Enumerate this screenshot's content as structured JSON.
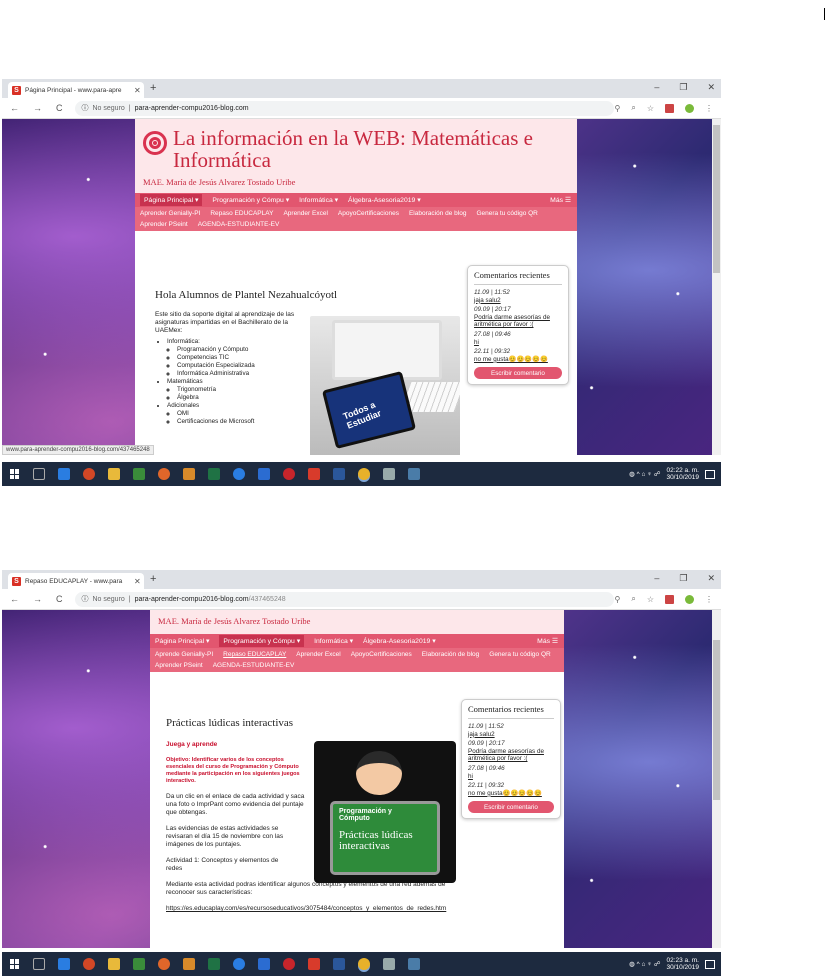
{
  "screen1": {
    "tab_title": "Página Principal - www.para-apre",
    "omnibox": {
      "security": "No seguro",
      "host": "para-aprender-compu2016-blog.com",
      "path": ""
    },
    "blog": {
      "title": "La información en la WEB: Matemáticas e Informática",
      "author": "MAE. María de Jesús Alvarez Tostado Uribe",
      "menu_primary": [
        "Página Principal ▾",
        "Programación y Cómpu ▾",
        "Informática ▾",
        "Álgebra-Asesoria2019 ▾"
      ],
      "menu_more": "Más ☰",
      "menu_secondary": [
        "Aprender Genially-PI",
        "Repaso EDUCAPLAY",
        "Aprender Excel",
        "ApoyoCertificaciones",
        "Elaboración de blog",
        "Genera tu código QR",
        "Aprender PSeint",
        "AGENDA-ESTUDIANTE-EV"
      ]
    },
    "post": {
      "title": "Hola Alumnos de Plantel Nezahualcóyotl",
      "intro": "Este sitio da soporte digital al aprendizaje de las asignaturas impartidas en el Bachillerato de la UAEMex:",
      "informatica": "Informática:",
      "informatica_items": [
        "Programación y Cómputo",
        "Competencias TIC",
        "Computación Especializada",
        "Informática Administrativa"
      ],
      "matematicas": "Matemáticas",
      "matematicas_items": [
        "Trigonometría",
        "Álgebra"
      ],
      "adicionales": "Adicionales",
      "adicionales_items": [
        "OMI",
        "Certificaciones de Microsoft"
      ],
      "image_text": "Todos a Estudiar"
    },
    "status_url": "www.para-aprender-compu2016-blog.com/437465248",
    "clock": {
      "time": "02:22 a. m.",
      "date": "30/10/2019"
    }
  },
  "screen2": {
    "tab_title": "Repaso EDUCAPLAY - www.para",
    "omnibox": {
      "security": "No seguro",
      "host": "para-aprender-compu2016-blog.com",
      "path": "/437465248"
    },
    "blog": {
      "author": "MAE. María de Jesús Alvarez Tostado Uribe",
      "menu_primary": [
        "Página Principal ▾",
        "Programación y Cómpu ▾",
        "Informática ▾",
        "Álgebra-Asesoria2019 ▾"
      ],
      "menu_more": "Más ☰",
      "menu_secondary": [
        "Aprende Genially-PI",
        "Repaso EDUCAPLAY",
        "Aprender Excel",
        "ApoyoCertificaciones",
        "Elaboración de blog",
        "Genera tu código QR",
        "Aprender PSeint",
        "AGENDA-ESTUDIANTE-EV"
      ]
    },
    "post": {
      "title": "Prácticas lúdicas interactivas",
      "subtitle": "Juega y aprende",
      "objective": "Objetivo: Identificar varios de los conceptos esenciales del curso de Programación y Cómputo mediante la participación en los siguientes juegos interactivo.",
      "p1": "Da un clic en el enlace de cada actividad y saca una foto o ImprPant como evidencia del puntaje que obtengas.",
      "p2": "Las evidencias de estas actividades se revisaran el día 15 de noviembre con las imágenes de los puntajes.",
      "activity": "Actividad 1: Conceptos y elementos de redes",
      "p3": "Mediante esta actividad podras identificar algunos conceptos y elementos de una red además de reconocer sus características:",
      "link": "https://es.educaplay.com/es/recursoseducativos/3075484/conceptos_y_elementos_de_redes.htm",
      "sign_top": "Programación y Cómputo",
      "sign_main": "Prácticas lúdicas interactivas"
    },
    "clock": {
      "time": "02:23 a. m.",
      "date": "30/10/2019"
    }
  },
  "widget": {
    "title": "Comentarios recientes",
    "comments": [
      {
        "meta": "11.09 | 11:52",
        "text": "jaja salu2"
      },
      {
        "meta": "09.09 | 20:17",
        "text": "Podría darme asesorías de aritmética por favor :("
      },
      {
        "meta": "27.08 | 09:46",
        "text": "hi"
      },
      {
        "meta": "22.11 | 09:32",
        "text": "no me gusta😊😊😊😊😊"
      }
    ],
    "button": "Escribir comentario"
  },
  "colors": {
    "accent": "#e2566f",
    "title": "#c8283f",
    "header_bg": "#fde7ea"
  }
}
